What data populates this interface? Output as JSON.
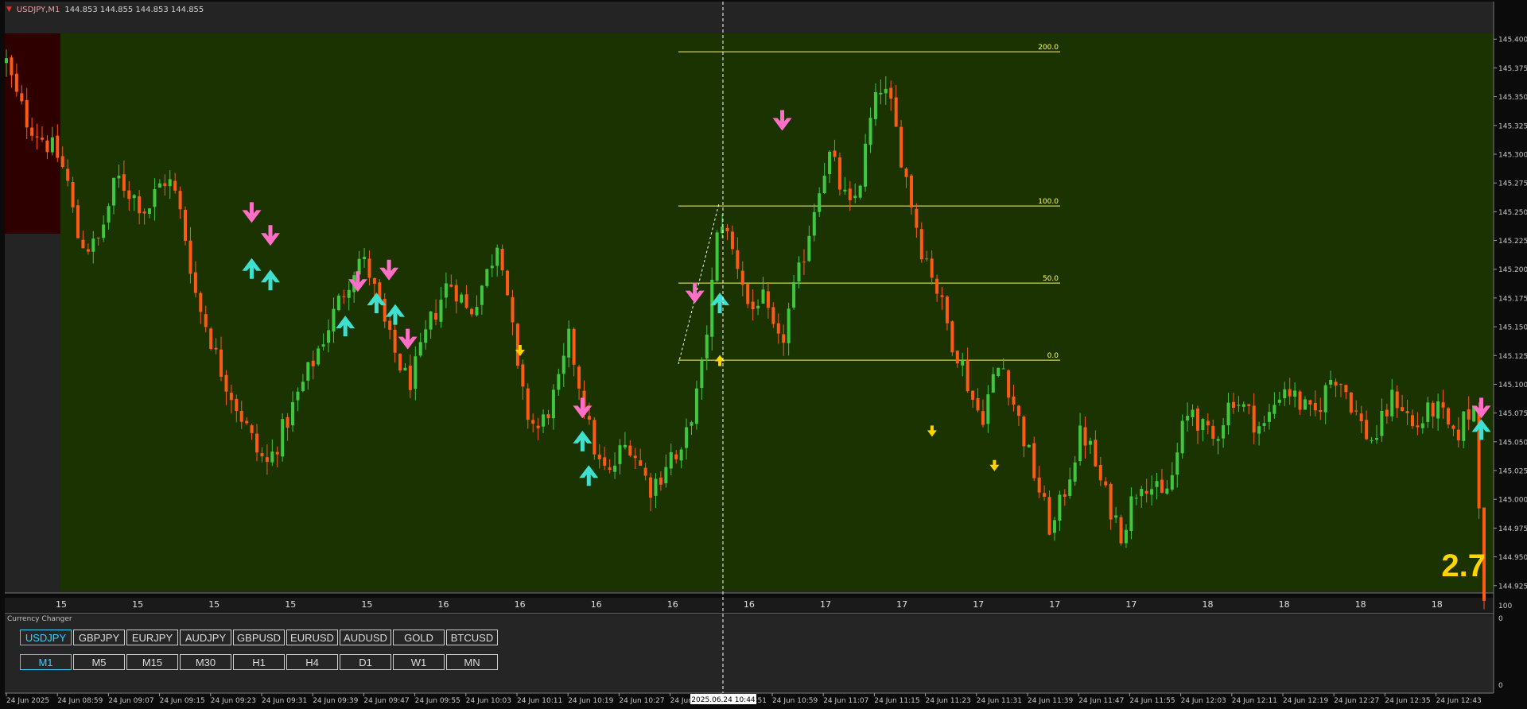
{
  "header": {
    "symbol": "USDJPY,M1",
    "quote": "144.853 144.855 144.853 144.855"
  },
  "colors": {
    "background": "#0b0b0b",
    "chart_bg": "#1a3300",
    "left_zone": "#2e0000",
    "bull": "#3fc83f",
    "bear": "#ff5a14",
    "fib": "#ffff5a",
    "arrow_up": "#40e0d0",
    "arrow_down": "#ff6ec7",
    "signal_yellow": "#ffd400"
  },
  "price_axis": {
    "labels": [
      "145.400",
      "145.375",
      "145.350",
      "145.325",
      "145.300",
      "145.275",
      "145.250",
      "145.225",
      "145.200",
      "145.175",
      "145.150",
      "145.125",
      "145.100",
      "145.075",
      "145.050",
      "145.025",
      "145.000",
      "144.975",
      "144.950",
      "144.925"
    ]
  },
  "indicator_axis": {
    "labels": [
      "100",
      "0",
      "0"
    ]
  },
  "fib_levels": [
    {
      "label": "200.0",
      "price": 145.389
    },
    {
      "label": "100.0",
      "price": 145.255
    },
    {
      "label": "50.0",
      "price": 145.188
    },
    {
      "label": "0.0",
      "price": 145.121
    }
  ],
  "indicator_numbers": [
    "15",
    "15",
    "15",
    "15",
    "15",
    "16",
    "16",
    "16",
    "16",
    "16",
    "17",
    "17",
    "17",
    "17",
    "17",
    "18",
    "18",
    "18",
    "18"
  ],
  "time_axis": {
    "labels": [
      "24 Jun 2025",
      "24 Jun 08:59",
      "24 Jun 09:07",
      "24 Jun 09:15",
      "24 Jun 09:23",
      "24 Jun 09:31",
      "24 Jun 09:39",
      "24 Jun 09:47",
      "24 Jun 09:55",
      "24 Jun 10:03",
      "24 Jun 10:11",
      "24 Jun 10:19",
      "24 Jun 10:27",
      "24 Jun",
      "24 Jun 10:51",
      "24 Jun 10:59",
      "24 Jun 11:07",
      "24 Jun 11:15",
      "24 Jun 11:23",
      "24 Jun 11:31",
      "24 Jun 11:39",
      "24 Jun 11:47",
      "24 Jun 11:55",
      "24 Jun 12:03",
      "24 Jun 12:11",
      "24 Jun 12:19",
      "24 Jun 12:27",
      "24 Jun 12:35",
      "24 Jun 12:43"
    ],
    "crosshair_label": "2025.06.24 10:44"
  },
  "currency_changer": {
    "title": "Currency Changer",
    "symbols": [
      {
        "label": "USDJPY",
        "active": true
      },
      {
        "label": "GBPJPY",
        "active": false
      },
      {
        "label": "EURJPY",
        "active": false
      },
      {
        "label": "AUDJPY",
        "active": false
      },
      {
        "label": "GBPUSD",
        "active": false
      },
      {
        "label": "EURUSD",
        "active": false
      },
      {
        "label": "AUDUSD",
        "active": false
      },
      {
        "label": "GOLD",
        "active": false
      },
      {
        "label": "BTCUSD",
        "active": false
      }
    ],
    "timeframes": [
      {
        "label": "M1",
        "active": true
      },
      {
        "label": "M5",
        "active": false
      },
      {
        "label": "M15",
        "active": false
      },
      {
        "label": "M30",
        "active": false
      },
      {
        "label": "H1",
        "active": false
      },
      {
        "label": "H4",
        "active": false
      },
      {
        "label": "D1",
        "active": false
      },
      {
        "label": "W1",
        "active": false
      },
      {
        "label": "MN",
        "active": false
      }
    ]
  },
  "spread_value": "2.7",
  "chart_data": {
    "type": "candlestick",
    "y_range": [
      144.92,
      145.405
    ],
    "path_prices": [
      145.38,
      145.35,
      145.33,
      145.32,
      145.31,
      145.3,
      145.28,
      145.23,
      145.22,
      145.22,
      145.25,
      145.28,
      145.27,
      145.26,
      145.25,
      145.27,
      145.28,
      145.26,
      145.22,
      145.17,
      145.15,
      145.12,
      145.1,
      145.08,
      145.06,
      145.04,
      145.03,
      145.05,
      145.07,
      145.09,
      145.11,
      145.13,
      145.15,
      145.17,
      145.19,
      145.21,
      145.2,
      145.17,
      145.14,
      145.12,
      145.1,
      145.12,
      145.15,
      145.17,
      145.19,
      145.18,
      145.16,
      145.18,
      145.2,
      145.23,
      145.17,
      145.1,
      145.07,
      145.06,
      145.08,
      145.1,
      145.14,
      145.1,
      145.06,
      145.03,
      145.02,
      145.04,
      145.05,
      145.03,
      145.01,
      145.02,
      145.04,
      145.03,
      145.07,
      145.1,
      145.17,
      145.25,
      145.22,
      145.2,
      145.16,
      145.18,
      145.15,
      145.13,
      145.17,
      145.2,
      145.24,
      145.28,
      145.3,
      145.27,
      145.25,
      145.28,
      145.33,
      145.36,
      145.34,
      145.3,
      145.26,
      145.22,
      145.2,
      145.17,
      145.14,
      145.12,
      145.09,
      145.07,
      145.1,
      145.12,
      145.09,
      145.06,
      145.03,
      145.0,
      144.97,
      145.0,
      145.03,
      145.06,
      145.04,
      145.01,
      144.99,
      144.97,
      145.0,
      145.02,
      145.01,
      145.0,
      145.02,
      145.06,
      145.08,
      145.06,
      145.05,
      145.07,
      145.09,
      145.08,
      145.07,
      145.06,
      145.08,
      145.1,
      145.09,
      145.08,
      145.07,
      145.09,
      145.11,
      145.1,
      145.08,
      145.06,
      145.05,
      145.07,
      145.09,
      145.08,
      145.06,
      145.07,
      145.08,
      145.07,
      145.05,
      145.07,
      145.08,
      144.92
    ],
    "arrows_up": [
      {
        "x": "09:29",
        "price": 145.2
      },
      {
        "x": "09:32",
        "price": 145.19
      },
      {
        "x": "09:44",
        "price": 145.15
      },
      {
        "x": "09:49",
        "price": 145.17
      },
      {
        "x": "09:52",
        "price": 145.16
      },
      {
        "x": "10:22",
        "price": 145.05
      },
      {
        "x": "10:23",
        "price": 145.02
      },
      {
        "x": "10:44",
        "price": 145.17
      },
      {
        "x": "12:46",
        "price": 145.06
      }
    ],
    "arrows_down": [
      {
        "x": "09:29",
        "price": 145.25
      },
      {
        "x": "09:32",
        "price": 145.23
      },
      {
        "x": "09:46",
        "price": 145.19
      },
      {
        "x": "09:51",
        "price": 145.2
      },
      {
        "x": "09:54",
        "price": 145.14
      },
      {
        "x": "10:22",
        "price": 145.08
      },
      {
        "x": "10:40",
        "price": 145.18
      },
      {
        "x": "10:54",
        "price": 145.33
      },
      {
        "x": "12:46",
        "price": 145.08
      }
    ],
    "signals_up": [
      {
        "x": "10:44",
        "price": 145.12
      }
    ],
    "signals_down": [
      {
        "x": "10:12",
        "price": 145.13
      },
      {
        "x": "11:18",
        "price": 145.06
      },
      {
        "x": "11:28",
        "price": 145.03
      }
    ]
  }
}
